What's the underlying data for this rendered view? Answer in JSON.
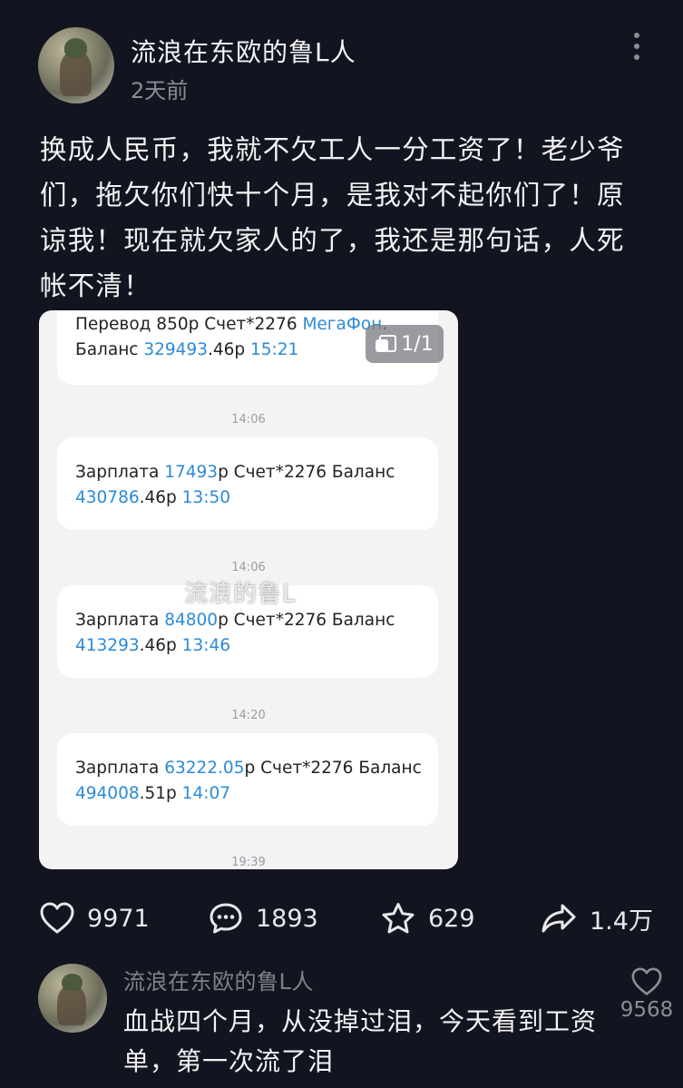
{
  "post": {
    "author": "流浪在东欧的鲁L人",
    "time": "2天前",
    "text": "换成人民币，我就不欠工人一分工资了！老少爷们，拖欠你们快十个月，是我对不起你们了！原谅我！现在就欠家人的了，我还是那句话，人死帐不清！"
  },
  "image": {
    "counter": "1/1",
    "watermark": "流浪的鲁L",
    "messages": [
      {
        "line1": [
          {
            "t": "Перевод 850р Счет*2276 ",
            "h": false
          },
          {
            "t": "МегаФон",
            "h": true
          },
          {
            "t": ".",
            "h": false
          }
        ],
        "line2": [
          {
            "t": "Баланс ",
            "h": false
          },
          {
            "t": "329493",
            "h": true
          },
          {
            "t": ".46р ",
            "h": false
          },
          {
            "t": "15:21",
            "h": true
          }
        ]
      },
      {
        "line1": [
          {
            "t": "Зарплата ",
            "h": false
          },
          {
            "t": "17493",
            "h": true
          },
          {
            "t": "р Счет*2276 Баланс",
            "h": false
          }
        ],
        "line2": [
          {
            "t": "430786",
            "h": true
          },
          {
            "t": ".46р ",
            "h": false
          },
          {
            "t": "13:50",
            "h": true
          }
        ]
      },
      {
        "line1": [
          {
            "t": "Зарплата ",
            "h": false
          },
          {
            "t": "84800",
            "h": true
          },
          {
            "t": "р Счет*2276 Баланс",
            "h": false
          }
        ],
        "line2": [
          {
            "t": "413293",
            "h": true
          },
          {
            "t": ".46р ",
            "h": false
          },
          {
            "t": "13:46",
            "h": true
          }
        ]
      },
      {
        "line1": [
          {
            "t": "Зарплата ",
            "h": false
          },
          {
            "t": "63222.05",
            "h": true
          },
          {
            "t": "р Счет*2276 Баланс",
            "h": false
          }
        ],
        "line2": [
          {
            "t": "494008",
            "h": true
          },
          {
            "t": ".51р ",
            "h": false
          },
          {
            "t": "14:07",
            "h": true
          }
        ]
      }
    ],
    "timestamps": [
      "14:06",
      "14:06",
      "14:20",
      "19:39"
    ]
  },
  "actions": {
    "likes": "9971",
    "comments": "1893",
    "favorites": "629",
    "shares": "1.4万"
  },
  "comment": {
    "author": "流浪在东欧的鲁L人",
    "text": "血战四个月，从没掉过泪，今天看到工资单，第一次流了泪",
    "likes": "9568"
  },
  "colors": {
    "background": "#121520",
    "highlight": "#2c8ad8",
    "muted": "#8a8d96"
  }
}
